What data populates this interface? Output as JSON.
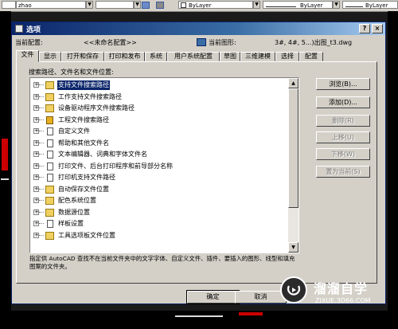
{
  "host_toolbar": {
    "user_field": "zhao",
    "layer1": "ByLayer",
    "layer2": "ByLayer",
    "layer3": "ByLayer"
  },
  "dialog": {
    "title": "选项",
    "help_btn": "?",
    "close_btn": "×"
  },
  "info": {
    "current_profile_label": "当前配置:",
    "current_profile_value": "<<未命名配置>>",
    "current_drawing_label": "当前图形:",
    "current_drawing_value": "3#, 4#, 5...)出图_t3.dwg"
  },
  "tabs": [
    "文件",
    "显示",
    "打开和保存",
    "打印和发布",
    "系统",
    "用户系统配置",
    "草图",
    "三维建模",
    "选择",
    "配置"
  ],
  "active_tab": 0,
  "search_label": "搜索路径、文件名和文件位置:",
  "tree_items": [
    {
      "label": "支持文件搜索路径",
      "icon": "folder",
      "selected": true
    },
    {
      "label": "工作支持文件搜索路径",
      "icon": "folder",
      "selected": false
    },
    {
      "label": "设备驱动程序文件搜索路径",
      "icon": "folder",
      "selected": false
    },
    {
      "label": "工程文件搜索路径",
      "icon": "gold",
      "selected": false
    },
    {
      "label": "自定义文件",
      "icon": "doc",
      "selected": false
    },
    {
      "label": "帮助和其他文件名",
      "icon": "doc",
      "selected": false
    },
    {
      "label": "文本编辑器、词典和字体文件名",
      "icon": "doc",
      "selected": false
    },
    {
      "label": "打印文件、后台打印程序和前导部分名称",
      "icon": "doc",
      "selected": false
    },
    {
      "label": "打印机支持文件路径",
      "icon": "doc",
      "selected": false
    },
    {
      "label": "自动保存文件位置",
      "icon": "folder",
      "selected": false
    },
    {
      "label": "配色系统位置",
      "icon": "folder",
      "selected": false
    },
    {
      "label": "数据源位置",
      "icon": "folder",
      "selected": false
    },
    {
      "label": "样板设置",
      "icon": "doc",
      "selected": false
    },
    {
      "label": "工具选项板文件位置",
      "icon": "folder",
      "selected": false
    }
  ],
  "description": "指定供 AutoCAD 查找不在当前文件夹中的文字字体、自定义文件、插件、要插入的图形、线型和填充图案的文件夹。",
  "right_buttons": [
    {
      "label": "浏览(B)...",
      "enabled": true
    },
    {
      "label": "添加(D)...",
      "enabled": true
    },
    {
      "label": "删除(R)",
      "enabled": false
    },
    {
      "label": "上移(U)",
      "enabled": false
    },
    {
      "label": "下移(W)",
      "enabled": false
    },
    {
      "label": "置为当前(S)",
      "enabled": false
    }
  ],
  "bottom_buttons": {
    "ok": "确定",
    "cancel": "取消"
  },
  "watermark": {
    "title": "溜溜自学",
    "url": "ZIXUE.3D66.COM"
  }
}
